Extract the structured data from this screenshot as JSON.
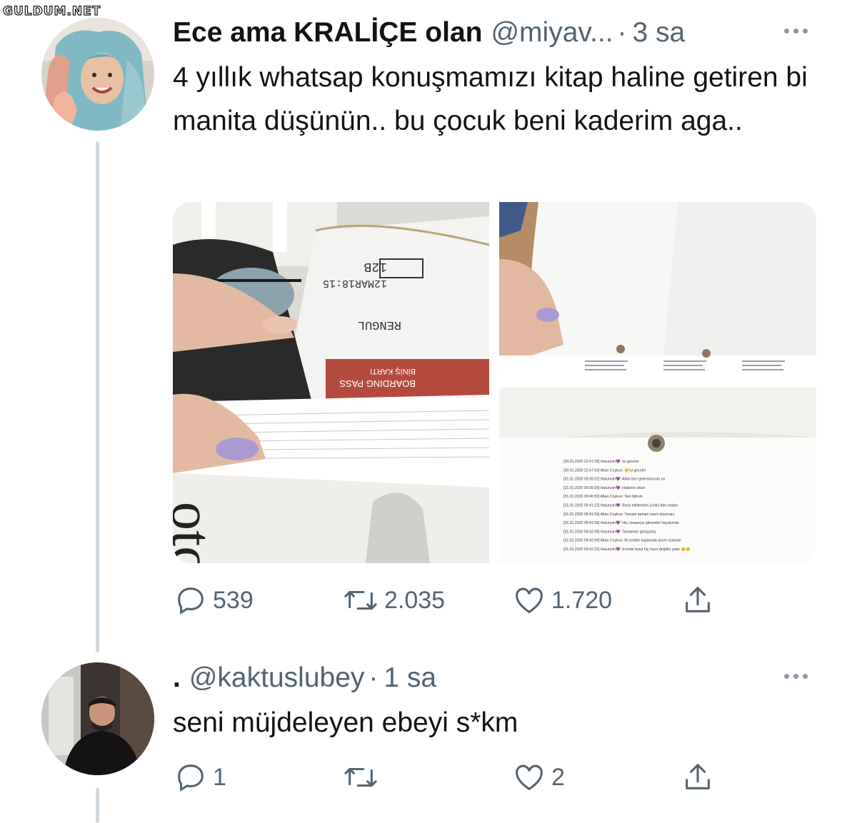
{
  "watermark": "GULDUM.NET",
  "tweet": {
    "display_name": "Ece ama KRALİÇE olan",
    "handle": "@miyav...",
    "separator": "·",
    "time": "3 sa",
    "text": "4 yıllık whatsap konuşmamızı kitap haline getiren bi manita düşünün.. bu çocuk beni kaderim aga..",
    "replies": "539",
    "retweets": "2.035",
    "likes": "1.720",
    "images": [
      {
        "name": "boarding-pass-book-photo",
        "description_icon": "photo-icon"
      },
      {
        "name": "book-pages-photo",
        "description_icon": "photo-icon"
      },
      {
        "name": "chat-log-page-photo",
        "description_icon": "photo-icon"
      }
    ],
    "photo_text": {
      "boarding_pass": "BOARDING PASS",
      "binis_karti": "BİNİŞ KARTI",
      "seat": "12B",
      "date": "12MAR18:15",
      "name_partial": "RENGUL"
    },
    "chat_lines": [
      "[30.01.2020 22:47:26] Hatunum💜: İyi geceler",
      "[30.01.2020 22:47:54] Altan Coşkun: 🙂İyi geceler",
      "[31.01.2020 09:39:22] Hatunum💜: Altan ben gelemiyorum ya",
      "[31.01.2020 09:39:29] Hatunum💜: Haberin olsun",
      "[31.01.2020 09:40:50] Altan Coşkun: Sen bilirsin",
      "[31.01.2020 09:41:22] Hatunum💜: Beya etkilenirim çünkü ben ondan",
      "[31.01.2020 09:41:55] Altan Coşkun: Tamam tamam nasıl istiyorsan",
      "[31.01.2020 09:41:56] Hatunum💜: Hiç cenazeye gitmedim hayatımda",
      "[31.01.2020 09:42:08] Hatunum💜: Tamamdır görüşürüz",
      "[31.01.2020 09:42:09] Altan Coşkun: Bi yerden başlamak lazım ozaman",
      "[31.01.2020 09:42:22] Hatunum💜: Evetde buna hiç hazır değilim yaan 😔😔"
    ]
  },
  "reply": {
    "display_name": ".",
    "handle": "@kaktuslubey",
    "separator": "·",
    "time": "1 sa",
    "text": "seni müjdeleyen ebeyi s*km",
    "replies": "1",
    "retweets": "",
    "likes": "2"
  },
  "colors": {
    "text": "#0f1419",
    "secondary": "#536471",
    "thread_line": "#cfd9de"
  }
}
